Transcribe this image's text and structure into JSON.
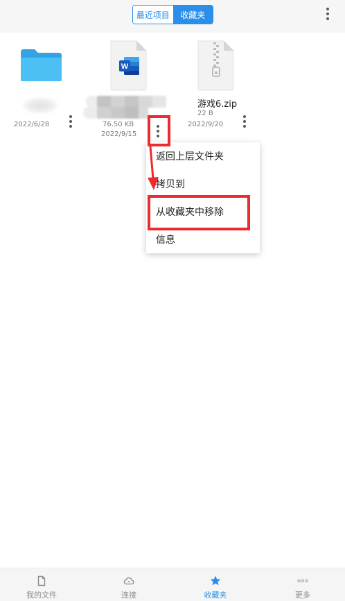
{
  "colors": {
    "accent": "#2b8ee9",
    "annotation": "#ec2b2f",
    "text_primary": "#222222",
    "text_secondary": "#7a7a7a"
  },
  "header": {
    "tabs": [
      {
        "label": "最近项目",
        "selected": false
      },
      {
        "label": "收藏夹",
        "selected": true
      }
    ],
    "more_icon": "more-vertical-icon"
  },
  "files": [
    {
      "kind": "folder",
      "icon": "folder-icon",
      "date": "2022/6/28",
      "more_icon": "more-vertical-icon"
    },
    {
      "kind": "document",
      "icon": "word-document-icon",
      "logo_letter": "W",
      "size": "76.50 KB",
      "date": "2022/9/15",
      "more_icon": "more-vertical-icon"
    },
    {
      "kind": "archive",
      "icon": "zip-archive-icon",
      "name": "游戏6.zip",
      "size": "22 B",
      "date": "2022/9/20",
      "more_icon": "more-vertical-icon"
    }
  ],
  "context_menu": {
    "items": [
      "返回上层文件夹",
      "拷贝到",
      "从收藏夹中移除",
      "信息"
    ]
  },
  "bottom_nav": {
    "items": [
      {
        "label": "我的文件",
        "icon": "document-icon",
        "active": false
      },
      {
        "label": "连接",
        "icon": "cloud-icon",
        "active": false
      },
      {
        "label": "收藏夹",
        "icon": "star-icon",
        "active": true
      },
      {
        "label": "更多",
        "icon": "more-horizontal-icon",
        "active": false
      }
    ]
  }
}
